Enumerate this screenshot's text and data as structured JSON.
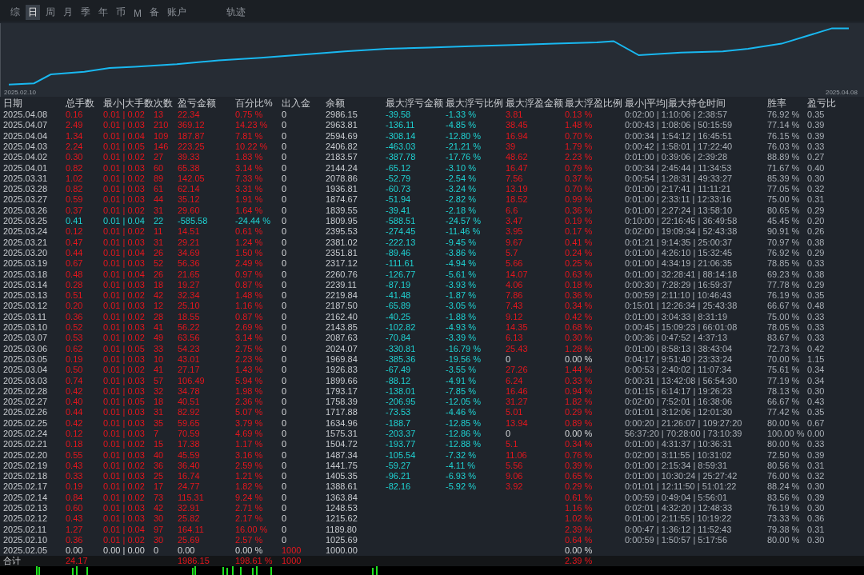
{
  "tabs": [
    {
      "label": "综",
      "selected": false
    },
    {
      "label": "日",
      "selected": true
    },
    {
      "label": "周",
      "selected": false
    },
    {
      "label": "月",
      "selected": false
    },
    {
      "label": "季",
      "selected": false
    },
    {
      "label": "年",
      "selected": false
    },
    {
      "label": "币",
      "selected": false
    },
    {
      "label": "M",
      "selected": false
    },
    {
      "label": "备",
      "selected": false
    },
    {
      "label": "账户",
      "selected": false
    },
    {
      "label": "轨迹",
      "selected": false
    }
  ],
  "equity_chart": {
    "start_label": "2025.02.10",
    "end_label": "2025.04.08"
  },
  "table": {
    "columns": [
      "日期",
      "总手数",
      "最小|大手数",
      "次数",
      "盈亏金额",
      "百分比%",
      "出入金",
      "余额",
      "最大浮亏金额",
      "最大浮亏比例",
      "最大浮盈金额",
      "最大浮盈比例",
      "最小|平均|最大持仓时间",
      "胜率",
      "盈亏比"
    ],
    "rows": [
      {
        "date": "2025.04.08",
        "lots": "0.16",
        "lot_range": "0.01 | 0.02",
        "trades": "13",
        "pnl": "22.34",
        "pnl_pct": "0.75 %",
        "flow": "0",
        "balance": "2986.15",
        "max_loss": "-39.58",
        "max_loss_pct": "-1.33 %",
        "max_profit": "3.81",
        "max_profit_pct": "0.13 %",
        "hold_times": "0:02:00 | 1:10:06 | 2:38:57",
        "win_rate": "76.92 %",
        "pl_ratio": "0.35",
        "kind": "profit",
        "flow_highlighted": false,
        "float_highlighted": true
      },
      {
        "date": "2025.04.07",
        "lots": "2.49",
        "lot_range": "0.01 | 0.03",
        "trades": "210",
        "pnl": "369.12",
        "pnl_pct": "14.23 %",
        "flow": "0",
        "balance": "2963.81",
        "max_loss": "-136.11",
        "max_loss_pct": "-4.85 %",
        "max_profit": "38.45",
        "max_profit_pct": "1.48 %",
        "hold_times": "0:00:43 | 1:08:06 | 50:15:59",
        "win_rate": "77.14 %",
        "pl_ratio": "0.39",
        "kind": "profit",
        "flow_highlighted": false,
        "float_highlighted": true
      },
      {
        "date": "2025.04.04",
        "lots": "1.34",
        "lot_range": "0.01 | 0.04",
        "trades": "109",
        "pnl": "187.87",
        "pnl_pct": "7.81 %",
        "flow": "0",
        "balance": "2594.69",
        "max_loss": "-308.14",
        "max_loss_pct": "-12.80 %",
        "max_profit": "16.94",
        "max_profit_pct": "0.70 %",
        "hold_times": "0:00:34 | 1:54:12 | 16:45:51",
        "win_rate": "76.15 %",
        "pl_ratio": "0.39",
        "kind": "profit",
        "flow_highlighted": false,
        "float_highlighted": true
      },
      {
        "date": "2025.04.03",
        "lots": "2.24",
        "lot_range": "0.01 | 0.05",
        "trades": "146",
        "pnl": "223.25",
        "pnl_pct": "10.22 %",
        "flow": "0",
        "balance": "2406.82",
        "max_loss": "-463.03",
        "max_loss_pct": "-21.21 %",
        "max_profit": "39",
        "max_profit_pct": "1.79 %",
        "hold_times": "0:00:42 | 1:58:01 | 17:22:40",
        "win_rate": "76.03 %",
        "pl_ratio": "0.33",
        "kind": "profit",
        "flow_highlighted": false,
        "float_highlighted": true
      },
      {
        "date": "2025.04.02",
        "lots": "0.30",
        "lot_range": "0.01 | 0.02",
        "trades": "27",
        "pnl": "39.33",
        "pnl_pct": "1.83 %",
        "flow": "0",
        "balance": "2183.57",
        "max_loss": "-387.78",
        "max_loss_pct": "-17.76 %",
        "max_profit": "48.62",
        "max_profit_pct": "2.23 %",
        "hold_times": "0:01:00 | 0:39:06 | 2:39:28",
        "win_rate": "88.89 %",
        "pl_ratio": "0.27",
        "kind": "profit",
        "flow_highlighted": false,
        "float_highlighted": true
      },
      {
        "date": "2025.04.01",
        "lots": "0.82",
        "lot_range": "0.01 | 0.03",
        "trades": "60",
        "pnl": "65.38",
        "pnl_pct": "3.14 %",
        "flow": "0",
        "balance": "2144.24",
        "max_loss": "-65.12",
        "max_loss_pct": "-3.10 %",
        "max_profit": "16.47",
        "max_profit_pct": "0.79 %",
        "hold_times": "0:00:34 | 2:45:44 | 11:34:53",
        "win_rate": "71.67 %",
        "pl_ratio": "0.40",
        "kind": "profit",
        "flow_highlighted": false,
        "float_highlighted": true
      },
      {
        "date": "2025.03.31",
        "lots": "1.02",
        "lot_range": "0.01 | 0.02",
        "trades": "89",
        "pnl": "142.05",
        "pnl_pct": "7.33 %",
        "flow": "0",
        "balance": "2078.86",
        "max_loss": "-52.79",
        "max_loss_pct": "-2.54 %",
        "max_profit": "7.56",
        "max_profit_pct": "0.37 %",
        "hold_times": "0:00:54 | 1:28:31 | 49:33:27",
        "win_rate": "85.39 %",
        "pl_ratio": "0.30",
        "kind": "profit",
        "flow_highlighted": false,
        "float_highlighted": true
      },
      {
        "date": "2025.03.28",
        "lots": "0.82",
        "lot_range": "0.01 | 0.03",
        "trades": "61",
        "pnl": "62.14",
        "pnl_pct": "3.31 %",
        "flow": "0",
        "balance": "1936.81",
        "max_loss": "-60.73",
        "max_loss_pct": "-3.24 %",
        "max_profit": "13.19",
        "max_profit_pct": "0.70 %",
        "hold_times": "0:01:00 | 2:17:41 | 11:11:21",
        "win_rate": "77.05 %",
        "pl_ratio": "0.32",
        "kind": "profit",
        "flow_highlighted": false,
        "float_highlighted": true
      },
      {
        "date": "2025.03.27",
        "lots": "0.59",
        "lot_range": "0.01 | 0.03",
        "trades": "44",
        "pnl": "35.12",
        "pnl_pct": "1.91 %",
        "flow": "0",
        "balance": "1874.67",
        "max_loss": "-51.94",
        "max_loss_pct": "-2.82 %",
        "max_profit": "18.52",
        "max_profit_pct": "0.99 %",
        "hold_times": "0:01:00 | 2:33:11 | 12:33:16",
        "win_rate": "75.00 %",
        "pl_ratio": "0.31",
        "kind": "profit",
        "flow_highlighted": false,
        "float_highlighted": true
      },
      {
        "date": "2025.03.26",
        "lots": "0.37",
        "lot_range": "0.01 | 0.02",
        "trades": "31",
        "pnl": "29.60",
        "pnl_pct": "1.64 %",
        "flow": "0",
        "balance": "1839.55",
        "max_loss": "-39.41",
        "max_loss_pct": "-2.18 %",
        "max_profit": "6.6",
        "max_profit_pct": "0.36 %",
        "hold_times": "0:01:00 | 2:27:24 | 13:58:10",
        "win_rate": "80.65 %",
        "pl_ratio": "0.29",
        "kind": "profit",
        "flow_highlighted": false,
        "float_highlighted": true
      },
      {
        "date": "2025.03.25",
        "lots": "0.41",
        "lot_range": "0.01 | 0.04",
        "trades": "22",
        "pnl": "-585.58",
        "pnl_pct": "-24.44 %",
        "flow": "0",
        "balance": "1809.95",
        "max_loss": "-588.51",
        "max_loss_pct": "-24.57 %",
        "max_profit": "3.47",
        "max_profit_pct": "0.19 %",
        "hold_times": "0:10:00 | 22:16:45 | 36:49:58",
        "win_rate": "45.45 %",
        "pl_ratio": "0.20",
        "kind": "loss",
        "flow_highlighted": false,
        "float_highlighted": true
      },
      {
        "date": "2025.03.24",
        "lots": "0.12",
        "lot_range": "0.01 | 0.02",
        "trades": "11",
        "pnl": "14.51",
        "pnl_pct": "0.61 %",
        "flow": "0",
        "balance": "2395.53",
        "max_loss": "-274.45",
        "max_loss_pct": "-11.46 %",
        "max_profit": "3.95",
        "max_profit_pct": "0.17 %",
        "hold_times": "0:02:00 | 19:09:34 | 52:43:38",
        "win_rate": "90.91 %",
        "pl_ratio": "0.26",
        "kind": "profit",
        "flow_highlighted": false,
        "float_highlighted": true
      },
      {
        "date": "2025.03.21",
        "lots": "0.47",
        "lot_range": "0.01 | 0.03",
        "trades": "31",
        "pnl": "29.21",
        "pnl_pct": "1.24 %",
        "flow": "0",
        "balance": "2381.02",
        "max_loss": "-222.13",
        "max_loss_pct": "-9.45 %",
        "max_profit": "9.67",
        "max_profit_pct": "0.41 %",
        "hold_times": "0:01:21 | 9:14:35 | 25:00:37",
        "win_rate": "70.97 %",
        "pl_ratio": "0.38",
        "kind": "profit",
        "flow_highlighted": false,
        "float_highlighted": true
      },
      {
        "date": "2025.03.20",
        "lots": "0.44",
        "lot_range": "0.01 | 0.04",
        "trades": "26",
        "pnl": "34.69",
        "pnl_pct": "1.50 %",
        "flow": "0",
        "balance": "2351.81",
        "max_loss": "-89.46",
        "max_loss_pct": "-3.86 %",
        "max_profit": "5.7",
        "max_profit_pct": "0.24 %",
        "hold_times": "0:01:00 | 4:26:10 | 15:32:45",
        "win_rate": "76.92 %",
        "pl_ratio": "0.29",
        "kind": "profit",
        "flow_highlighted": false,
        "float_highlighted": true
      },
      {
        "date": "2025.03.19",
        "lots": "0.67",
        "lot_range": "0.01 | 0.03",
        "trades": "52",
        "pnl": "56.36",
        "pnl_pct": "2.49 %",
        "flow": "0",
        "balance": "2317.12",
        "max_loss": "-111.61",
        "max_loss_pct": "-4.94 %",
        "max_profit": "5.66",
        "max_profit_pct": "0.25 %",
        "hold_times": "0:01:00 | 4:34:19 | 21:06:35",
        "win_rate": "78.85 %",
        "pl_ratio": "0.33",
        "kind": "profit",
        "flow_highlighted": false,
        "float_highlighted": true
      },
      {
        "date": "2025.03.18",
        "lots": "0.48",
        "lot_range": "0.01 | 0.04",
        "trades": "26",
        "pnl": "21.65",
        "pnl_pct": "0.97 %",
        "flow": "0",
        "balance": "2260.76",
        "max_loss": "-126.77",
        "max_loss_pct": "-5.61 %",
        "max_profit": "14.07",
        "max_profit_pct": "0.63 %",
        "hold_times": "0:01:00 | 32:28:41 | 88:14:18",
        "win_rate": "69.23 %",
        "pl_ratio": "0.38",
        "kind": "profit",
        "flow_highlighted": false,
        "float_highlighted": true
      },
      {
        "date": "2025.03.14",
        "lots": "0.28",
        "lot_range": "0.01 | 0.03",
        "trades": "18",
        "pnl": "19.27",
        "pnl_pct": "0.87 %",
        "flow": "0",
        "balance": "2239.11",
        "max_loss": "-87.19",
        "max_loss_pct": "-3.93 %",
        "max_profit": "4.06",
        "max_profit_pct": "0.18 %",
        "hold_times": "0:00:30 | 7:28:29 | 16:59:37",
        "win_rate": "77.78 %",
        "pl_ratio": "0.29",
        "kind": "profit",
        "flow_highlighted": false,
        "float_highlighted": true
      },
      {
        "date": "2025.03.13",
        "lots": "0.51",
        "lot_range": "0.01 | 0.02",
        "trades": "42",
        "pnl": "32.34",
        "pnl_pct": "1.48 %",
        "flow": "0",
        "balance": "2219.84",
        "max_loss": "-41.48",
        "max_loss_pct": "-1.87 %",
        "max_profit": "7.86",
        "max_profit_pct": "0.36 %",
        "hold_times": "0:00:59 | 2:11:10 | 10:46:43",
        "win_rate": "76.19 %",
        "pl_ratio": "0.35",
        "kind": "profit",
        "flow_highlighted": false,
        "float_highlighted": true
      },
      {
        "date": "2025.03.12",
        "lots": "0.20",
        "lot_range": "0.01 | 0.03",
        "trades": "12",
        "pnl": "25.10",
        "pnl_pct": "1.16 %",
        "flow": "0",
        "balance": "2187.50",
        "max_loss": "-65.89",
        "max_loss_pct": "-3.05 %",
        "max_profit": "7.43",
        "max_profit_pct": "0.34 %",
        "hold_times": "0:15:01 | 12:26:34 | 25:43:38",
        "win_rate": "66.67 %",
        "pl_ratio": "0.48",
        "kind": "profit",
        "flow_highlighted": false,
        "float_highlighted": true
      },
      {
        "date": "2025.03.11",
        "lots": "0.36",
        "lot_range": "0.01 | 0.02",
        "trades": "28",
        "pnl": "18.55",
        "pnl_pct": "0.87 %",
        "flow": "0",
        "balance": "2162.40",
        "max_loss": "-40.25",
        "max_loss_pct": "-1.88 %",
        "max_profit": "9.12",
        "max_profit_pct": "0.42 %",
        "hold_times": "0:01:00 | 3:04:33 | 8:31:19",
        "win_rate": "75.00 %",
        "pl_ratio": "0.33",
        "kind": "profit",
        "flow_highlighted": false,
        "float_highlighted": true
      },
      {
        "date": "2025.03.10",
        "lots": "0.52",
        "lot_range": "0.01 | 0.03",
        "trades": "41",
        "pnl": "56.22",
        "pnl_pct": "2.69 %",
        "flow": "0",
        "balance": "2143.85",
        "max_loss": "-102.82",
        "max_loss_pct": "-4.93 %",
        "max_profit": "14.35",
        "max_profit_pct": "0.68 %",
        "hold_times": "0:00:45 | 15:09:23 | 66:01:08",
        "win_rate": "78.05 %",
        "pl_ratio": "0.33",
        "kind": "profit",
        "flow_highlighted": false,
        "float_highlighted": true
      },
      {
        "date": "2025.03.07",
        "lots": "0.53",
        "lot_range": "0.01 | 0.02",
        "trades": "49",
        "pnl": "63.56",
        "pnl_pct": "3.14 %",
        "flow": "0",
        "balance": "2087.63",
        "max_loss": "-70.84",
        "max_loss_pct": "-3.39 %",
        "max_profit": "6.13",
        "max_profit_pct": "0.30 %",
        "hold_times": "0:00:36 | 0:47:52 | 4:37:13",
        "win_rate": "83.67 %",
        "pl_ratio": "0.33",
        "kind": "profit",
        "flow_highlighted": false,
        "float_highlighted": true
      },
      {
        "date": "2025.03.06",
        "lots": "0.62",
        "lot_range": "0.01 | 0.05",
        "trades": "33",
        "pnl": "54.23",
        "pnl_pct": "2.75 %",
        "flow": "0",
        "balance": "2024.07",
        "max_loss": "-330.81",
        "max_loss_pct": "-16.79 %",
        "max_profit": "25.43",
        "max_profit_pct": "1.28 %",
        "hold_times": "0:01:00 | 8:58:13 | 38:43:04",
        "win_rate": "72.73 %",
        "pl_ratio": "0.42",
        "kind": "profit",
        "flow_highlighted": false,
        "float_highlighted": true
      },
      {
        "date": "2025.03.05",
        "lots": "0.19",
        "lot_range": "0.01 | 0.03",
        "trades": "10",
        "pnl": "43.01",
        "pnl_pct": "2.23 %",
        "flow": "0",
        "balance": "1969.84",
        "max_loss": "-385.36",
        "max_loss_pct": "-19.56 %",
        "max_profit": "0",
        "max_profit_pct": "0.00 %",
        "hold_times": "0:04:17 | 9:51:40 | 23:33:24",
        "win_rate": "70.00 %",
        "pl_ratio": "1.15",
        "kind": "profit",
        "flow_highlighted": false,
        "float_highlighted": false
      },
      {
        "date": "2025.03.04",
        "lots": "0.50",
        "lot_range": "0.01 | 0.02",
        "trades": "41",
        "pnl": "27.17",
        "pnl_pct": "1.43 %",
        "flow": "0",
        "balance": "1926.83",
        "max_loss": "-67.49",
        "max_loss_pct": "-3.55 %",
        "max_profit": "27.26",
        "max_profit_pct": "1.44 %",
        "hold_times": "0:00:53 | 2:40:02 | 11:07:34",
        "win_rate": "75.61 %",
        "pl_ratio": "0.34",
        "kind": "profit",
        "flow_highlighted": false,
        "float_highlighted": true
      },
      {
        "date": "2025.03.03",
        "lots": "0.74",
        "lot_range": "0.01 | 0.03",
        "trades": "57",
        "pnl": "106.49",
        "pnl_pct": "5.94 %",
        "flow": "0",
        "balance": "1899.66",
        "max_loss": "-88.12",
        "max_loss_pct": "-4.91 %",
        "max_profit": "6.24",
        "max_profit_pct": "0.33 %",
        "hold_times": "0:00:31 | 13:42:08 | 56:54:30",
        "win_rate": "77.19 %",
        "pl_ratio": "0.34",
        "kind": "profit",
        "flow_highlighted": false,
        "float_highlighted": true
      },
      {
        "date": "2025.02.28",
        "lots": "0.42",
        "lot_range": "0.01 | 0.03",
        "trades": "32",
        "pnl": "34.78",
        "pnl_pct": "1.98 %",
        "flow": "0",
        "balance": "1793.17",
        "max_loss": "-138.01",
        "max_loss_pct": "-7.85 %",
        "max_profit": "16.46",
        "max_profit_pct": "0.94 %",
        "hold_times": "0:01:15 | 6:14:17 | 19:26:23",
        "win_rate": "78.13 %",
        "pl_ratio": "0.30",
        "kind": "profit",
        "flow_highlighted": false,
        "float_highlighted": true
      },
      {
        "date": "2025.02.27",
        "lots": "0.40",
        "lot_range": "0.01 | 0.05",
        "trades": "18",
        "pnl": "40.51",
        "pnl_pct": "2.36 %",
        "flow": "0",
        "balance": "1758.39",
        "max_loss": "-206.95",
        "max_loss_pct": "-12.05 %",
        "max_profit": "31.27",
        "max_profit_pct": "1.82 %",
        "hold_times": "0:02:00 | 7:52:01 | 16:38:06",
        "win_rate": "66.67 %",
        "pl_ratio": "0.43",
        "kind": "profit",
        "flow_highlighted": false,
        "float_highlighted": true
      },
      {
        "date": "2025.02.26",
        "lots": "0.44",
        "lot_range": "0.01 | 0.03",
        "trades": "31",
        "pnl": "82.92",
        "pnl_pct": "5.07 %",
        "flow": "0",
        "balance": "1717.88",
        "max_loss": "-73.53",
        "max_loss_pct": "-4.46 %",
        "max_profit": "5.01",
        "max_profit_pct": "0.29 %",
        "hold_times": "0:01:01 | 3:12:06 | 12:01:30",
        "win_rate": "77.42 %",
        "pl_ratio": "0.35",
        "kind": "profit",
        "flow_highlighted": false,
        "float_highlighted": true
      },
      {
        "date": "2025.02.25",
        "lots": "0.42",
        "lot_range": "0.01 | 0.03",
        "trades": "35",
        "pnl": "59.65",
        "pnl_pct": "3.79 %",
        "flow": "0",
        "balance": "1634.96",
        "max_loss": "-188.7",
        "max_loss_pct": "-12.85 %",
        "max_profit": "13.94",
        "max_profit_pct": "0.89 %",
        "hold_times": "0:00:20 | 21:26:07 | 109:27:20",
        "win_rate": "80.00 %",
        "pl_ratio": "0.67",
        "kind": "profit",
        "flow_highlighted": false,
        "float_highlighted": true
      },
      {
        "date": "2025.02.24",
        "lots": "0.12",
        "lot_range": "0.01 | 0.03",
        "trades": "7",
        "pnl": "70.59",
        "pnl_pct": "4.69 %",
        "flow": "0",
        "balance": "1575.31",
        "max_loss": "-203.37",
        "max_loss_pct": "-12.86 %",
        "max_profit": "0",
        "max_profit_pct": "0.00 %",
        "hold_times": "56:37:20 | 70:28:00 | 73:10:39",
        "win_rate": "100.00 %",
        "pl_ratio": "0.00",
        "kind": "profit",
        "flow_highlighted": false,
        "float_highlighted": false
      },
      {
        "date": "2025.02.21",
        "lots": "0.18",
        "lot_range": "0.01 | 0.02",
        "trades": "15",
        "pnl": "17.38",
        "pnl_pct": "1.17 %",
        "flow": "0",
        "balance": "1504.72",
        "max_loss": "-193.77",
        "max_loss_pct": "-12.88 %",
        "max_profit": "5.1",
        "max_profit_pct": "0.34 %",
        "hold_times": "0:01:00 | 4:31:37 | 10:36:31",
        "win_rate": "80.00 %",
        "pl_ratio": "0.33",
        "kind": "profit",
        "flow_highlighted": false,
        "float_highlighted": true
      },
      {
        "date": "2025.02.20",
        "lots": "0.55",
        "lot_range": "0.01 | 0.03",
        "trades": "40",
        "pnl": "45.59",
        "pnl_pct": "3.16 %",
        "flow": "0",
        "balance": "1487.34",
        "max_loss": "-105.54",
        "max_loss_pct": "-7.32 %",
        "max_profit": "11.06",
        "max_profit_pct": "0.76 %",
        "hold_times": "0:02:00 | 3:11:55 | 10:31:02",
        "win_rate": "72.50 %",
        "pl_ratio": "0.39",
        "kind": "profit",
        "flow_highlighted": false,
        "float_highlighted": true
      },
      {
        "date": "2025.02.19",
        "lots": "0.43",
        "lot_range": "0.01 | 0.02",
        "trades": "36",
        "pnl": "36.40",
        "pnl_pct": "2.59 %",
        "flow": "0",
        "balance": "1441.75",
        "max_loss": "-59.27",
        "max_loss_pct": "-4.11 %",
        "max_profit": "5.56",
        "max_profit_pct": "0.39 %",
        "hold_times": "0:01:00 | 2:15:34 | 8:59:31",
        "win_rate": "80.56 %",
        "pl_ratio": "0.31",
        "kind": "profit",
        "flow_highlighted": false,
        "float_highlighted": true
      },
      {
        "date": "2025.02.18",
        "lots": "0.33",
        "lot_range": "0.01 | 0.03",
        "trades": "25",
        "pnl": "16.74",
        "pnl_pct": "1.21 %",
        "flow": "0",
        "balance": "1405.35",
        "max_loss": "-96.21",
        "max_loss_pct": "-6.93 %",
        "max_profit": "9.06",
        "max_profit_pct": "0.65 %",
        "hold_times": "0:01:00 | 10:30:24 | 25:27:42",
        "win_rate": "76.00 %",
        "pl_ratio": "0.32",
        "kind": "profit",
        "flow_highlighted": false,
        "float_highlighted": true
      },
      {
        "date": "2025.02.17",
        "lots": "0.19",
        "lot_range": "0.01 | 0.02",
        "trades": "17",
        "pnl": "24.77",
        "pnl_pct": "1.82 %",
        "flow": "0",
        "balance": "1388.61",
        "max_loss": "-82.16",
        "max_loss_pct": "-5.92 %",
        "max_profit": "3.92",
        "max_profit_pct": "0.29 %",
        "hold_times": "0:01:01 | 12:11:50 | 51:01:22",
        "win_rate": "88.24 %",
        "pl_ratio": "0.30",
        "kind": "profit",
        "flow_highlighted": false,
        "float_highlighted": true
      },
      {
        "date": "2025.02.14",
        "lots": "0.84",
        "lot_range": "0.01 | 0.02",
        "trades": "73",
        "pnl": "115.31",
        "pnl_pct": "9.24 %",
        "flow": "0",
        "balance": "1363.84",
        "max_profit_pct": "0.61 %",
        "hold_times": "0:00:59 | 0:49:04 | 5:56:01",
        "win_rate": "83.56 %",
        "pl_ratio": "0.39",
        "kind": "profit",
        "flow_highlighted": false,
        "float_highlighted": true
      },
      {
        "date": "2025.02.13",
        "lots": "0.60",
        "lot_range": "0.01 | 0.03",
        "trades": "42",
        "pnl": "32.91",
        "pnl_pct": "2.71 %",
        "flow": "0",
        "balance": "1248.53",
        "max_profit_pct": "1.16 %",
        "hold_times": "0:02:01 | 4:32:20 | 12:48:33",
        "win_rate": "76.19 %",
        "pl_ratio": "0.30",
        "kind": "profit",
        "flow_highlighted": false,
        "float_highlighted": true
      },
      {
        "date": "2025.02.12",
        "lots": "0.43",
        "lot_range": "0.01 | 0.03",
        "trades": "30",
        "pnl": "25.82",
        "pnl_pct": "2.17 %",
        "flow": "0",
        "balance": "1215.62",
        "max_profit_pct": "1.02 %",
        "hold_times": "0:01:00 | 2:11:55 | 10:19:22",
        "win_rate": "73.33 %",
        "pl_ratio": "0.36",
        "kind": "profit",
        "flow_highlighted": false,
        "float_highlighted": true
      },
      {
        "date": "2025.02.11",
        "lots": "1.27",
        "lot_range": "0.01 | 0.04",
        "trades": "97",
        "pnl": "164.11",
        "pnl_pct": "16.00 %",
        "flow": "0",
        "balance": "1189.80",
        "max_profit_pct": "2.39 %",
        "hold_times": "0:00:47 | 1:36:12 | 11:52:43",
        "win_rate": "79.38 %",
        "pl_ratio": "0.31",
        "kind": "profit",
        "flow_highlighted": false,
        "float_highlighted": true
      },
      {
        "date": "2025.02.10",
        "lots": "0.36",
        "lot_range": "0.01 | 0.02",
        "trades": "30",
        "pnl": "25.69",
        "pnl_pct": "2.57 %",
        "flow": "0",
        "balance": "1025.69",
        "max_profit_pct": "0.64 %",
        "hold_times": "0:00:59 | 1:50:57 | 5:17:56",
        "win_rate": "80.00 %",
        "pl_ratio": "0.30",
        "kind": "profit",
        "flow_highlighted": false,
        "float_highlighted": true
      },
      {
        "date": "2025.02.05",
        "lots": "0.00",
        "lot_range": "0.00 | 0.00",
        "trades": "0",
        "pnl": "0.00",
        "pnl_pct": "0.00 %",
        "flow": "1000",
        "balance": "1000.00",
        "max_profit_pct": "0.00 %",
        "kind": "flat",
        "flow_highlighted": true,
        "float_highlighted": false
      }
    ],
    "total": {
      "date": "合计",
      "lots": "24.17",
      "pnl": "1986.15",
      "pnl_pct": "198.61 %",
      "flow": "1000",
      "max_profit_pct": "2.39 %",
      "kind": "profit",
      "flow_highlighted": true,
      "float_highlighted": true
    }
  }
}
